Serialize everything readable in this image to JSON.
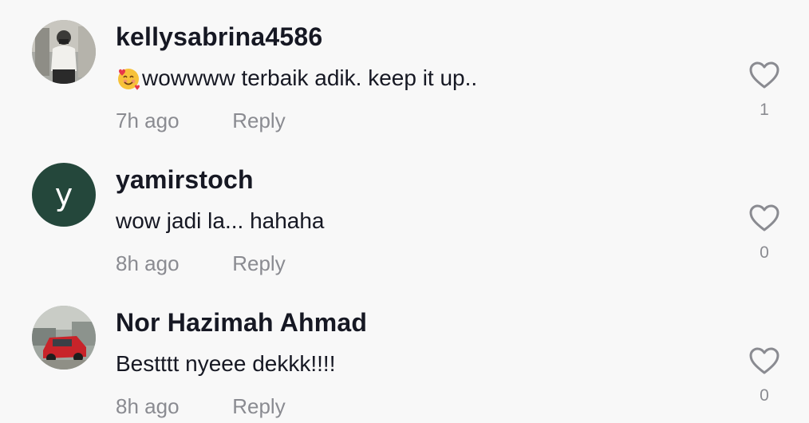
{
  "comments": [
    {
      "username": "kellysabrina4586",
      "emoji": "smiling-face-with-hearts",
      "text": "wowwww terbaik adik. keep it up..",
      "time": "7h ago",
      "reply_label": "Reply",
      "likes": "1",
      "avatar": "photo"
    },
    {
      "username": "yamirstoch",
      "text": "wow jadi la... hahaha",
      "time": "8h ago",
      "reply_label": "Reply",
      "likes": "0",
      "avatar_letter": "y",
      "avatar_color": "#24473b"
    },
    {
      "username": "Nor Hazimah Ahmad",
      "text": "Bestttt nyeee dekkk!!!!",
      "time": "8h ago",
      "reply_label": "Reply",
      "likes": "0",
      "avatar": "photo"
    }
  ],
  "icons": {
    "like": "heart-outline-icon"
  },
  "colors": {
    "background": "#f8f8f8",
    "text": "#161823",
    "muted": "#8a8b91"
  }
}
